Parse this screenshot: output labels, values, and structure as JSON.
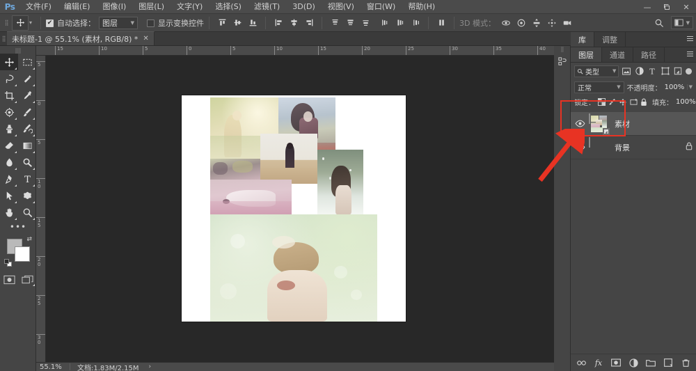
{
  "app": {
    "name": "Ps",
    "logo_text": "Ps"
  },
  "menu": {
    "items": [
      {
        "label": "文件(F)",
        "name": "menu-file"
      },
      {
        "label": "编辑(E)",
        "name": "menu-edit"
      },
      {
        "label": "图像(I)",
        "name": "menu-image"
      },
      {
        "label": "图层(L)",
        "name": "menu-layer"
      },
      {
        "label": "文字(Y)",
        "name": "menu-type"
      },
      {
        "label": "选择(S)",
        "name": "menu-select"
      },
      {
        "label": "滤镜(T)",
        "name": "menu-filter"
      },
      {
        "label": "3D(D)",
        "name": "menu-3d"
      },
      {
        "label": "视图(V)",
        "name": "menu-view"
      },
      {
        "label": "窗口(W)",
        "name": "menu-window"
      },
      {
        "label": "帮助(H)",
        "name": "menu-help"
      }
    ]
  },
  "window_controls": {
    "minimize": "—",
    "restore": "❐",
    "close": "✕"
  },
  "options_bar": {
    "tool_icon": "move-tool-icon",
    "auto_select_label": "自动选择：",
    "auto_select_checked": true,
    "auto_select_value": "图层",
    "show_transform_label": "显示变换控件",
    "show_transform_checked": false,
    "mode_3d_label": "3D 模式：",
    "search_icon": "search-icon",
    "workspace_icon": "workspace-switcher-icon",
    "align_icons": [
      "align-top-edges-icon",
      "align-vertical-centers-icon",
      "align-bottom-edges-icon",
      "align-left-edges-icon",
      "align-horizontal-centers-icon",
      "align-right-edges-icon",
      "distribute-top-edges-icon",
      "distribute-vertical-centers-icon",
      "distribute-bottom-edges-icon",
      "distribute-left-edges-icon",
      "distribute-horizontal-centers-icon",
      "distribute-right-edges-icon"
    ],
    "icons_3d": [
      "rotate-3d-icon",
      "roll-3d-icon",
      "drag-3d-icon",
      "slide-3d-icon",
      "scale-3d-icon"
    ],
    "align_more_icon": "align-more-icon"
  },
  "document_tab": {
    "title": "未标题-1 @ 55.1% (素材, RGB/8) *",
    "close_glyph": "✕"
  },
  "toolbar": {
    "tools": [
      {
        "name": "move-tool",
        "label": "移动工具",
        "active": true,
        "has_flyout": true
      },
      {
        "name": "rectangular-marquee-tool",
        "label": "矩形选框工具",
        "has_flyout": true
      },
      {
        "name": "lasso-tool",
        "label": "套索工具",
        "has_flyout": true
      },
      {
        "name": "quick-selection-tool",
        "label": "快速选择工具",
        "has_flyout": true
      },
      {
        "name": "crop-tool",
        "label": "裁剪工具",
        "has_flyout": true
      },
      {
        "name": "eyedropper-tool",
        "label": "吸管工具",
        "has_flyout": true
      },
      {
        "name": "spot-healing-brush-tool",
        "label": "污点修复画笔工具",
        "has_flyout": true
      },
      {
        "name": "brush-tool",
        "label": "画笔工具",
        "has_flyout": true
      },
      {
        "name": "clone-stamp-tool",
        "label": "仿制图章工具",
        "has_flyout": true
      },
      {
        "name": "history-brush-tool",
        "label": "历史记录画笔工具",
        "has_flyout": true
      },
      {
        "name": "eraser-tool",
        "label": "橡皮擦工具",
        "has_flyout": true
      },
      {
        "name": "gradient-tool",
        "label": "渐变工具",
        "has_flyout": true
      },
      {
        "name": "blur-tool",
        "label": "模糊工具",
        "has_flyout": true
      },
      {
        "name": "dodge-tool",
        "label": "减淡工具",
        "has_flyout": true
      },
      {
        "name": "pen-tool",
        "label": "钢笔工具",
        "has_flyout": true
      },
      {
        "name": "horizontal-type-tool",
        "label": "横排文字工具",
        "has_flyout": true
      },
      {
        "name": "path-selection-tool",
        "label": "路径选择工具",
        "has_flyout": true
      },
      {
        "name": "rectangle-shape-tool",
        "label": "矩形工具",
        "has_flyout": true
      },
      {
        "name": "hand-tool",
        "label": "抓手工具",
        "has_flyout": true
      },
      {
        "name": "zoom-tool",
        "label": "缩放工具",
        "has_flyout": true
      }
    ],
    "more_tools_glyph": "•••",
    "foreground_color": "#b9b9b9",
    "background_color": "#ffffff",
    "swap_icon": "swap-colors-icon",
    "default_colors_icon": "default-colors-icon",
    "quick_mask_icon": "quick-mask-icon",
    "screen_mode_icon": "screen-mode-icon"
  },
  "rulers": {
    "horizontal_ticks": [
      "15",
      "10",
      "5",
      "0",
      "5",
      "10",
      "15",
      "20",
      "25",
      "30",
      "35",
      "40"
    ],
    "vertical_ticks": [
      "5",
      "0",
      "5",
      "10",
      "15",
      "20",
      "25",
      "30"
    ]
  },
  "status_bar": {
    "zoom": "55.1%",
    "doc_label": "文档:1.83M/2.15M",
    "arrow": "›"
  },
  "panels": {
    "top_tabs": [
      {
        "label": "库",
        "name": "tab-libraries",
        "active": true
      },
      {
        "label": "调整",
        "name": "tab-adjustments",
        "active": false
      }
    ],
    "layer_tabs": [
      {
        "label": "图层",
        "name": "tab-layers",
        "active": true
      },
      {
        "label": "通道",
        "name": "tab-channels",
        "active": false
      },
      {
        "label": "路径",
        "name": "tab-paths",
        "active": false
      }
    ],
    "filter": {
      "search_icon": "search-icon",
      "type_label": "类型",
      "caret": "▾",
      "icons": [
        "filter-pixel-icon",
        "filter-adjustment-icon",
        "filter-type-icon",
        "filter-shape-icon",
        "filter-smart-object-icon"
      ],
      "toggle_name": "filter-toggle-switch"
    },
    "blend": {
      "mode": "正常",
      "caret": "▾",
      "opacity_label": "不透明度：",
      "opacity_value": "100%"
    },
    "lock": {
      "label": "锁定：",
      "icons": [
        "lock-transparent-pixels-icon",
        "lock-image-pixels-icon",
        "lock-position-icon",
        "lock-artboard-nesting-icon",
        "lock-all-icon"
      ],
      "fill_label": "填充：",
      "fill_value": "100%"
    },
    "layers": [
      {
        "name_text": "素材",
        "selected": true,
        "visible": true,
        "eye_icon": "eye-icon",
        "thumb": "collage-thumbnail",
        "smart_object_badge": "smart-object-icon",
        "locked": false
      },
      {
        "name_text": "背景",
        "selected": false,
        "visible": true,
        "eye_icon": "eye-icon",
        "thumb": "white-thumbnail",
        "smart_object_badge": null,
        "locked": true,
        "lock_icon": "lock-icon"
      }
    ],
    "footer_icons": [
      "link-layers-icon",
      "layer-style-fx-icon",
      "add-layer-mask-icon",
      "new-adjustment-layer-icon",
      "new-group-icon",
      "new-layer-icon",
      "delete-layer-icon"
    ],
    "footer_fx_label": "fx"
  },
  "dock_rail": {
    "icons": [
      "history-panel-icon"
    ]
  },
  "annotation": {
    "rect_color": "#e83323",
    "arrow_color": "#e83323",
    "rect_name": "red-highlight-rectangle",
    "arrow_name": "red-pointer-arrow"
  },
  "canvas": {
    "artboard_background": "#ffffff",
    "workspace_background": "#282828",
    "collage_cells": [
      {
        "name": "photo-girl-sunlight",
        "c1": "#e9e3c6",
        "c2": "#cdd3a4",
        "c3": "#f4efdc"
      },
      {
        "name": "photo-girl-scarf",
        "c1": "#b9c4cf",
        "c2": "#8e7d84",
        "c3": "#d8dde2"
      },
      {
        "name": "photo-field-lavender",
        "c1": "#d9c3cb",
        "c2": "#a89aa0",
        "c3": "#e7d5db"
      },
      {
        "name": "photo-girl-walking",
        "c1": "#e3ddd2",
        "c2": "#c9b79c",
        "c3": "#f0ece3"
      },
      {
        "name": "photo-girl-snow",
        "c1": "#dfe5e0",
        "c2": "#8e9a8c",
        "c3": "#eef2ee"
      },
      {
        "name": "photo-girl-pink-field",
        "c1": "#e6cdd4",
        "c2": "#cfa9b6",
        "c3": "#f2e2e7"
      },
      {
        "name": "photo-girl-back-bokeh",
        "c1": "#dce7d6",
        "c2": "#c7d3b4",
        "c3": "#eef3e7"
      }
    ]
  }
}
